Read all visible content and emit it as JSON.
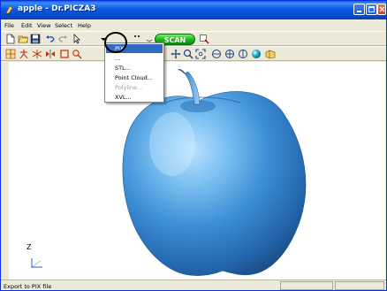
{
  "window": {
    "title": "apple - Dr.PICZA3"
  },
  "menubar": {
    "items": [
      "File",
      "Edit",
      "View",
      "Select",
      "Help"
    ]
  },
  "toolbar": {
    "scan_label": "SCAN"
  },
  "export_menu": {
    "items": [
      {
        "label": "PIX",
        "state": "highlighted"
      },
      {
        "label": "...",
        "state": "normal"
      },
      {
        "label": "STL...",
        "state": "normal"
      },
      {
        "label": "Point Cloud...",
        "state": "normal"
      },
      {
        "label": "Polyline...",
        "state": "disabled"
      },
      {
        "label": "XVL...",
        "state": "normal"
      }
    ]
  },
  "axis_indicator": {
    "label": "Z"
  },
  "statusbar": {
    "text": "Export to PIX file"
  },
  "colors": {
    "title_blue": "#0a5fe8",
    "scan_green": "#18b317",
    "menu_highlight": "#316ac5",
    "apple_blue": "#3d8fd6"
  }
}
